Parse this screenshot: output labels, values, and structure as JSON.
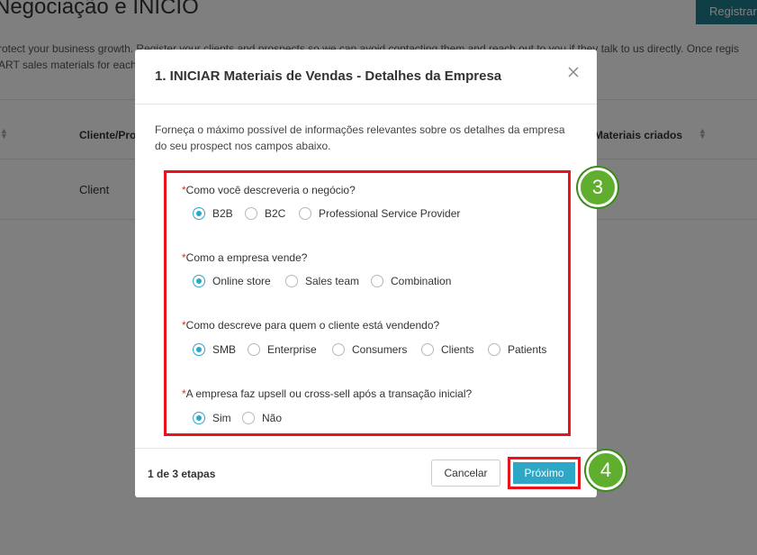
{
  "background": {
    "page_title": "Negociação e INICIO",
    "register_button": "Registrar",
    "description_line1": "rotect your business growth. Register your clients and prospects so we can avoid contacting them and reach out to you if they talk to us directly. Once regis",
    "description_line2": "ART sales materials for each",
    "columns": {
      "client": "Cliente/Pro",
      "materials": "Materiais criados"
    },
    "row_type": "Client"
  },
  "modal": {
    "title": "1. INICIAR Materiais de Vendas - Detalhes da Empresa",
    "intro": "Forneça o máximo possível de informações relevantes sobre os detalhes da empresa do seu prospect nos campos abaixo.",
    "questions": [
      {
        "label": "Como você descreveria o negócio?",
        "options": [
          "B2B",
          "B2C",
          "Professional Service Provider"
        ],
        "selected": "B2B"
      },
      {
        "label": "Como a empresa vende?",
        "options": [
          "Online store",
          "Sales team",
          "Combination"
        ],
        "selected": "Online store"
      },
      {
        "label": "Como descreve para quem o cliente está vendendo?",
        "options": [
          "SMB",
          "Enterprise",
          "Consumers",
          "Clients",
          "Patients"
        ],
        "selected": "SMB"
      },
      {
        "label": "A empresa faz upsell ou cross-sell após a transação inicial?",
        "options": [
          "Sim",
          "Não"
        ],
        "selected": "Sim"
      }
    ],
    "required_mark": "*",
    "footer": {
      "steps": "1 de 3 etapas",
      "cancel": "Cancelar",
      "next": "Próximo"
    }
  },
  "annotations": {
    "badge_questions": "3",
    "badge_next": "4"
  },
  "colors": {
    "accent": "#2ea6c5",
    "highlight": "#e8141c",
    "badge": "#5fae2e",
    "register": "#1e7d8c"
  }
}
